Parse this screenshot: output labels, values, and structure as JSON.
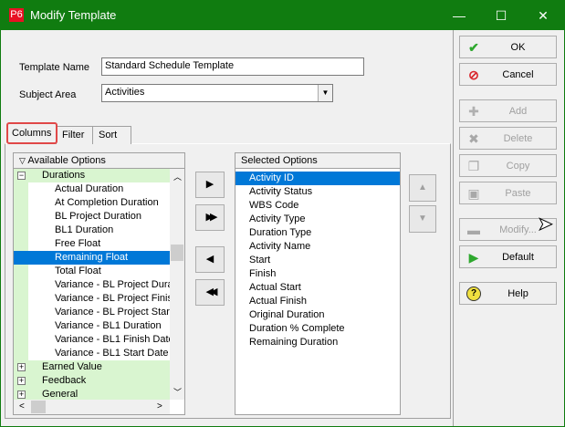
{
  "window": {
    "logo": "P6",
    "title": "Modify Template",
    "minimize": "—",
    "maximize": "☐",
    "close": "✕"
  },
  "form": {
    "template_name_label": "Template Name",
    "template_name_value": "Standard Schedule Template",
    "subject_area_label": "Subject Area",
    "subject_area_value": "Activities"
  },
  "tabs": [
    {
      "label": "Columns"
    },
    {
      "label": "Filter"
    },
    {
      "label": "Sort"
    }
  ],
  "available": {
    "header": "Available Options",
    "groups": [
      {
        "label": "Durations",
        "expanded": true,
        "items": [
          "Actual Duration",
          "At Completion Duration",
          "BL Project Duration",
          "BL1 Duration",
          "Free Float",
          "Remaining Float",
          "Total Float",
          "Variance - BL Project Duration",
          "Variance - BL Project Finish",
          "Variance - BL Project Start",
          "Variance - BL1 Duration",
          "Variance - BL1 Finish Date",
          "Variance - BL1 Start Date"
        ],
        "selected": "Remaining Float"
      },
      {
        "label": "Earned Value"
      },
      {
        "label": "Feedback"
      },
      {
        "label": "General"
      }
    ]
  },
  "selected": {
    "header": "Selected Options",
    "items": [
      "Activity ID",
      "Activity Status",
      "WBS Code",
      "Activity Type",
      "Duration Type",
      "Activity Name",
      "Start",
      "Finish",
      "Actual Start",
      "Actual Finish",
      "Original Duration",
      "Duration % Complete",
      "Remaining Duration"
    ],
    "selected": "Activity ID"
  },
  "move": {
    "add": "▶",
    "add_all": "▶▶",
    "remove": "◀",
    "remove_all": "◀◀",
    "up": "▲",
    "down": "▼"
  },
  "buttons": {
    "ok": "OK",
    "cancel": "Cancel",
    "add": "Add",
    "delete": "Delete",
    "copy": "Copy",
    "paste": "Paste",
    "modify": "Modify...",
    "default": "Default",
    "help": "Help"
  },
  "colors": {
    "titlebar": "#107c10",
    "selection": "#0078d7",
    "group": "#d9f5d0",
    "highlight": "#e04848"
  }
}
